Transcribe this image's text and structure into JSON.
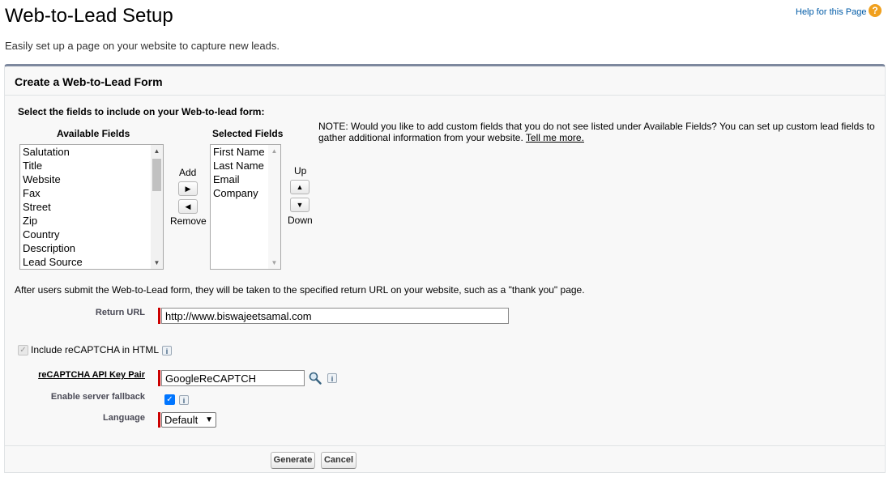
{
  "header": {
    "title": "Web-to-Lead Setup",
    "help_link": "Help for this Page",
    "help_icon": "?",
    "description": "Easily set up a page on your website to capture new leads."
  },
  "panel": {
    "title": "Create a Web-to-Lead Form",
    "select_fields_label": "Select the fields to include on your Web-to-lead form:",
    "available_fields_label": "Available Fields",
    "selected_fields_label": "Selected Fields",
    "available_fields": [
      "Salutation",
      "Title",
      "Website",
      "Fax",
      "Street",
      "Zip",
      "Country",
      "Description",
      "Lead Source"
    ],
    "selected_fields": [
      "First Name",
      "Last Name",
      "Email",
      "Company"
    ],
    "add_label": "Add",
    "remove_label": "Remove",
    "up_label": "Up",
    "down_label": "Down",
    "note_text": "NOTE: Would you like to add custom fields that you do not see listed under Available Fields? You can set up custom lead fields to gather additional information from your website.",
    "note_link": "Tell me more.",
    "after_submit_text": "After users submit the Web-to-Lead form, they will be taken to the specified return URL on your website, such as a \"thank you\" page."
  },
  "form": {
    "return_url_label": "Return URL",
    "return_url_value": "http://www.biswajeetsamal.com",
    "recaptcha_checkbox_label": "Include reCAPTCHA in HTML",
    "recaptcha_checked": true,
    "api_key_label": "reCAPTCHA API Key Pair",
    "api_key_value": "GoogleReCAPTCH",
    "server_fallback_label": "Enable server fallback",
    "server_fallback_checked": true,
    "language_label": "Language",
    "language_value": "Default",
    "info_glyph": "i"
  },
  "buttons": {
    "generate": "Generate",
    "cancel": "Cancel"
  },
  "colors": {
    "accent_border": "#7d889e",
    "required": "#cc0000",
    "link": "#015ba7",
    "help_icon": "#f0a01e"
  }
}
